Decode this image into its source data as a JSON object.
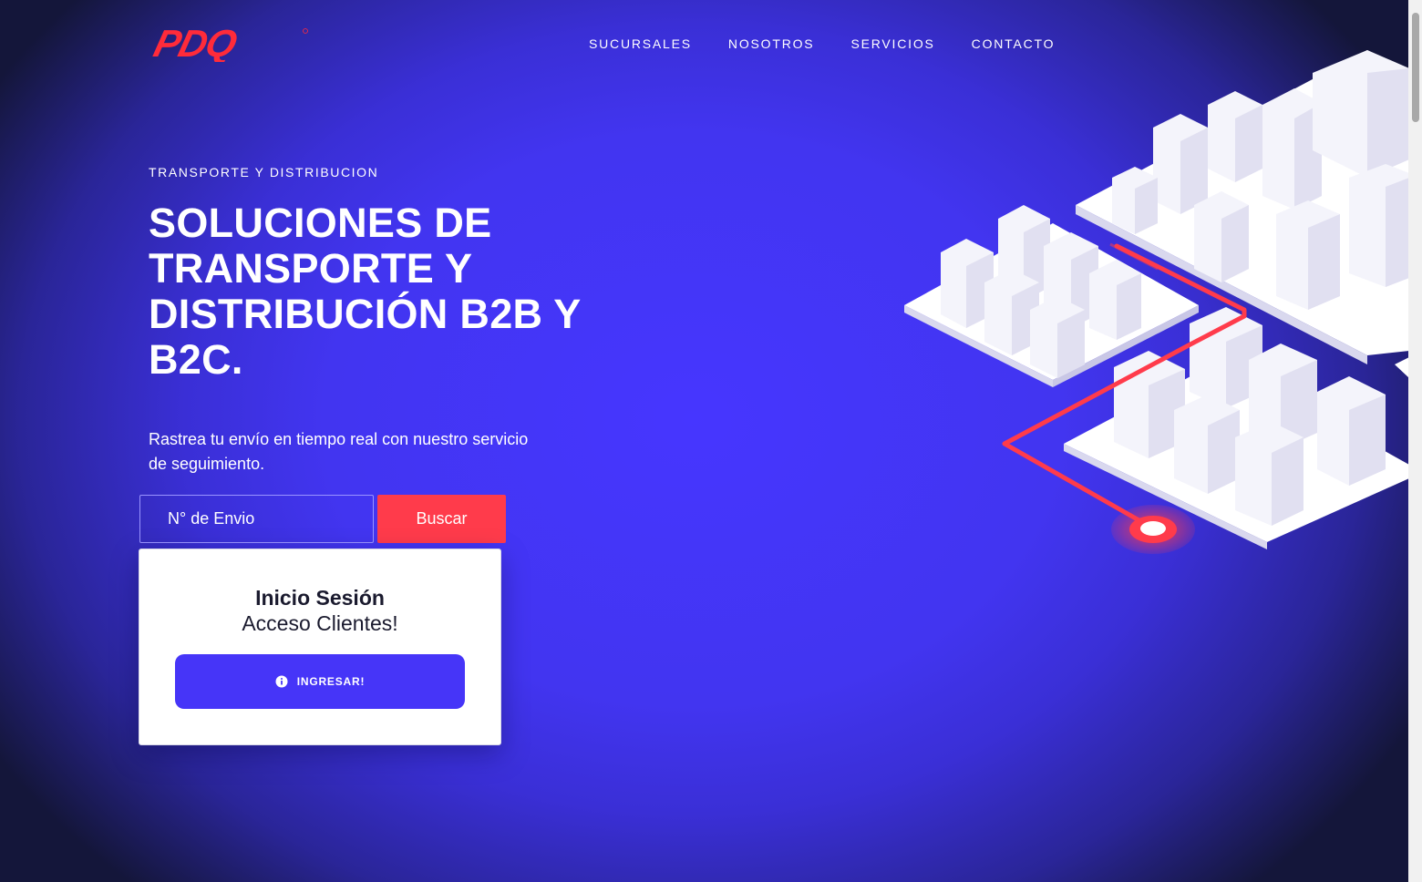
{
  "brand": {
    "logo_text": "PDQ",
    "accent_red": "#ff3b4b",
    "primary_blue": "#4635f8"
  },
  "nav": {
    "items": [
      {
        "label": "SUCURSALES"
      },
      {
        "label": "NOSOTROS"
      },
      {
        "label": "SERVICIOS"
      },
      {
        "label": "CONTACTO"
      }
    ]
  },
  "hero": {
    "eyebrow": "TRANSPORTE Y DISTRIBUCION",
    "title": "SOLUCIONES DE TRANSPORTE Y DISTRIBUCIÓN B2B Y B2C.",
    "description": "Rastrea tu envío en tiempo real con nuestro servicio de seguimiento."
  },
  "tracking": {
    "placeholder": "N° de Envio",
    "value": "",
    "button_label": "Buscar"
  },
  "login": {
    "title": "Inicio Sesión",
    "subtitle": "Acceso Clientes!",
    "button_label": "INGRESAR!",
    "button_icon": "info-circle-icon"
  },
  "illustration": {
    "icon": "isometric-city-route-illustration"
  }
}
